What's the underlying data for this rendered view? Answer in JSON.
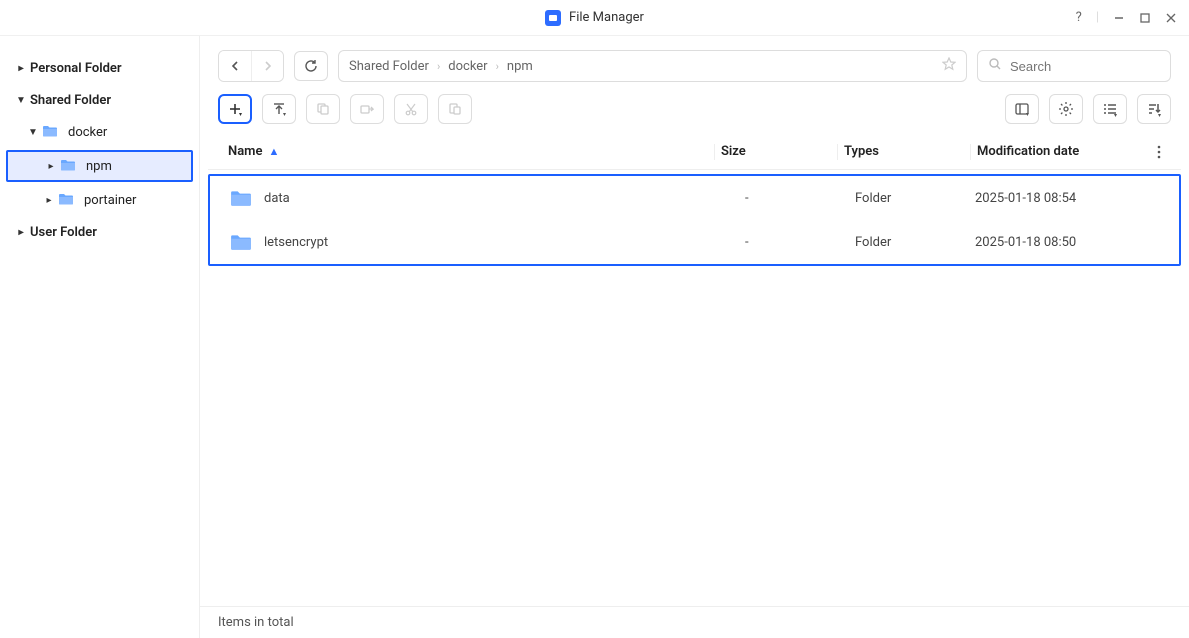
{
  "app": {
    "title": "File Manager"
  },
  "window_controls": {
    "help_tip": "?"
  },
  "sidebar": {
    "items": [
      {
        "label": "Personal Folder",
        "depth": 0,
        "bold": true,
        "caret": "right",
        "icon": false,
        "selected": false
      },
      {
        "label": "Shared Folder",
        "depth": 0,
        "bold": true,
        "caret": "down",
        "icon": false,
        "selected": false
      },
      {
        "label": "docker",
        "depth": 1,
        "bold": false,
        "caret": "down",
        "icon": true,
        "selected": false
      },
      {
        "label": "npm",
        "depth": 2,
        "bold": false,
        "caret": "right",
        "icon": true,
        "selected": true
      },
      {
        "label": "portainer",
        "depth": 2,
        "bold": false,
        "caret": "right",
        "icon": true,
        "selected": false
      },
      {
        "label": "User Folder",
        "depth": 0,
        "bold": true,
        "caret": "right",
        "icon": false,
        "selected": false
      }
    ]
  },
  "breadcrumb": {
    "segments": [
      "Shared Folder",
      "docker",
      "npm"
    ]
  },
  "search": {
    "placeholder": "Search"
  },
  "table": {
    "headers": {
      "name": "Name",
      "size": "Size",
      "types": "Types",
      "date": "Modification date"
    },
    "sort": {
      "column": "name",
      "dir": "asc"
    },
    "rows": [
      {
        "name": "data",
        "size": "-",
        "types": "Folder",
        "date": "2025-01-18 08:54"
      },
      {
        "name": "letsencrypt",
        "size": "-",
        "types": "Folder",
        "date": "2025-01-18 08:50"
      }
    ]
  },
  "status": {
    "text": "Items in total"
  },
  "icons": {
    "app_square_color": "#2d6cff",
    "folder_color": "#5b9dff"
  }
}
